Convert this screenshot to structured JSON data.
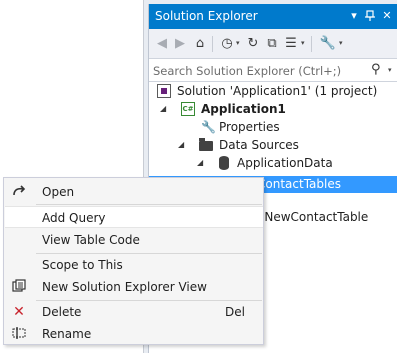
{
  "panel": {
    "title": "Solution Explorer",
    "title_icons": [
      "dropdown-arrow-icon",
      "pin-icon",
      "close-icon"
    ]
  },
  "toolbar": {
    "icons": [
      "back-icon",
      "forward-icon",
      "home-icon",
      "history-icon",
      "refresh-icon",
      "collapse-all-icon",
      "show-all-files-icon",
      "properties-wrench-icon"
    ]
  },
  "search": {
    "placeholder": "Search Solution Explorer (Ctrl+;)"
  },
  "tree": {
    "solution": "Solution 'Application1' (1 project)",
    "project": "Application1",
    "project_icon": "C#",
    "properties": "Properties",
    "data_sources": "Data Sources",
    "application_data": "ApplicationData",
    "contact_tables": "ContactTables",
    "contact_tables_partial": "ContactTables",
    "hidden_item_partial": "eNewContactTable"
  },
  "context_menu": {
    "items": [
      {
        "label": "Open",
        "icon": "open-redo-arrow-icon"
      },
      {
        "label": "Add Query"
      },
      {
        "label": "View Table Code"
      },
      {
        "label": "Scope to This"
      },
      {
        "label": "New Solution Explorer View",
        "icon": "new-view-icon"
      },
      {
        "label": "Delete",
        "icon": "delete-x-icon",
        "shortcut": "Del"
      },
      {
        "label": "Rename",
        "icon": "rename-icon"
      }
    ]
  },
  "colors": {
    "titlebar": "#007acc",
    "selection": "#3399ff",
    "menu_bg": "#f5f5f5",
    "delete_red": "#c8232c"
  }
}
